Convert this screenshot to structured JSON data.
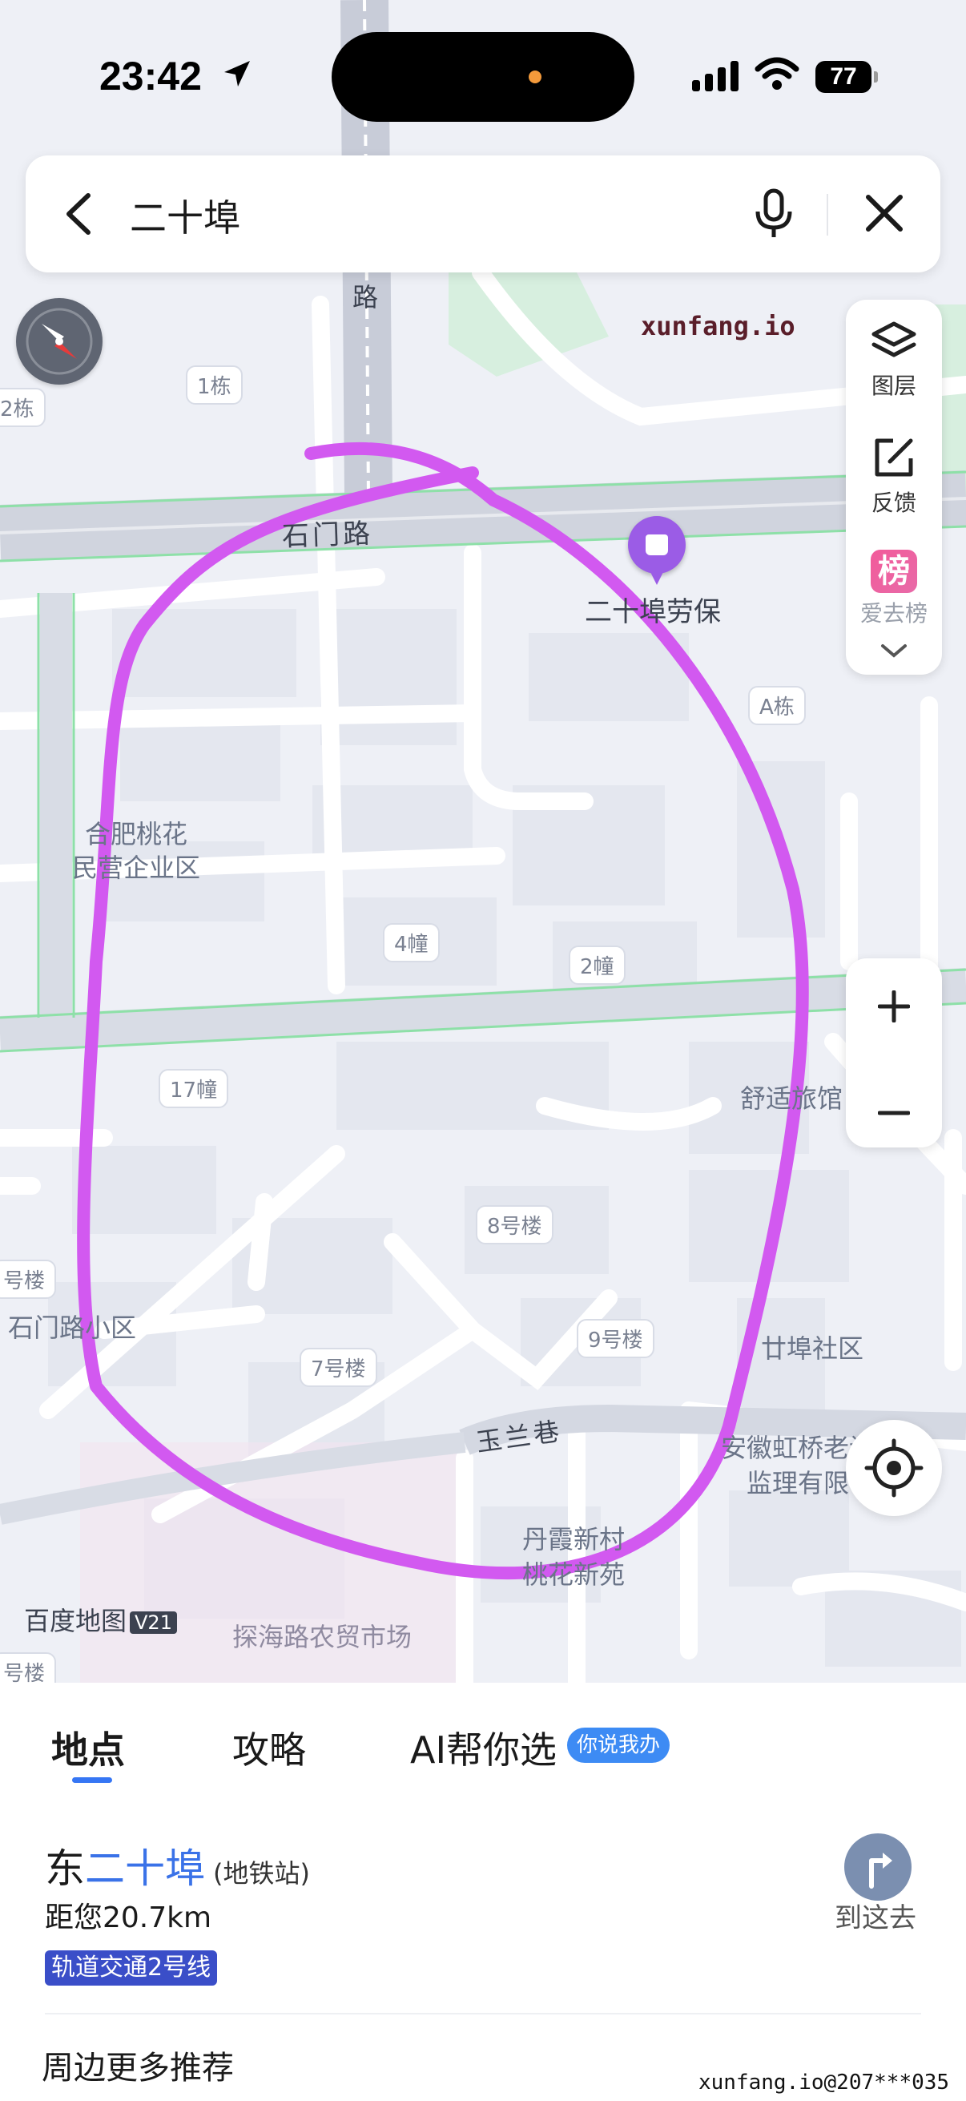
{
  "status_bar": {
    "time": "23:42",
    "battery": "77"
  },
  "search": {
    "query": "二十埠"
  },
  "map": {
    "watermark": "xunfang.io",
    "brand": "百度地图",
    "brand_version": "V21",
    "roads": {
      "shimen": "石门路",
      "lu": "路",
      "yulan": "玉兰巷"
    },
    "poi": {
      "name": "二十埠劳保"
    },
    "areas": {
      "hefei": [
        "合肥桃花",
        "民营企业区"
      ],
      "shimen_xiaoqu": "石门路小区",
      "shuyu": "舒适旅馆",
      "ershibu_shequ": "廿埠社区",
      "anhui": [
        "安徽虹桥老设",
        "监理有限"
      ],
      "danxia": [
        "丹霞新村",
        "桃花新苑"
      ],
      "tanhai": "探海路农贸市场"
    },
    "buildings": {
      "b1": "1栋",
      "b2": "2栋",
      "a": "A栋",
      "c4": "4幢",
      "c2": "2幢",
      "c17": "17幢",
      "h8": "8号楼",
      "h7": "7号楼",
      "h9": "9号楼",
      "h_left": "号楼",
      "h_left2": "号楼"
    }
  },
  "controls": {
    "layers": "图层",
    "feedback": "反馈",
    "rank_icon": "榜",
    "rank": "爱去榜"
  },
  "sheet": {
    "tabs": [
      "地点",
      "攻略",
      "AI帮你选"
    ],
    "ai_badge": "你说我办",
    "result": {
      "title_prefix": "东",
      "title_highlight": "二十埠",
      "title_sub": "(地铁站)",
      "distance": "距您20.7km",
      "line": "轨道交通2号线",
      "go": "到这去"
    },
    "more": "周边更多推荐",
    "watermark": "xunfang.io@207***035"
  },
  "colors": {
    "accent": "#3676f4",
    "annotation": "#d259f0",
    "map_bg": "#eef0f6"
  }
}
